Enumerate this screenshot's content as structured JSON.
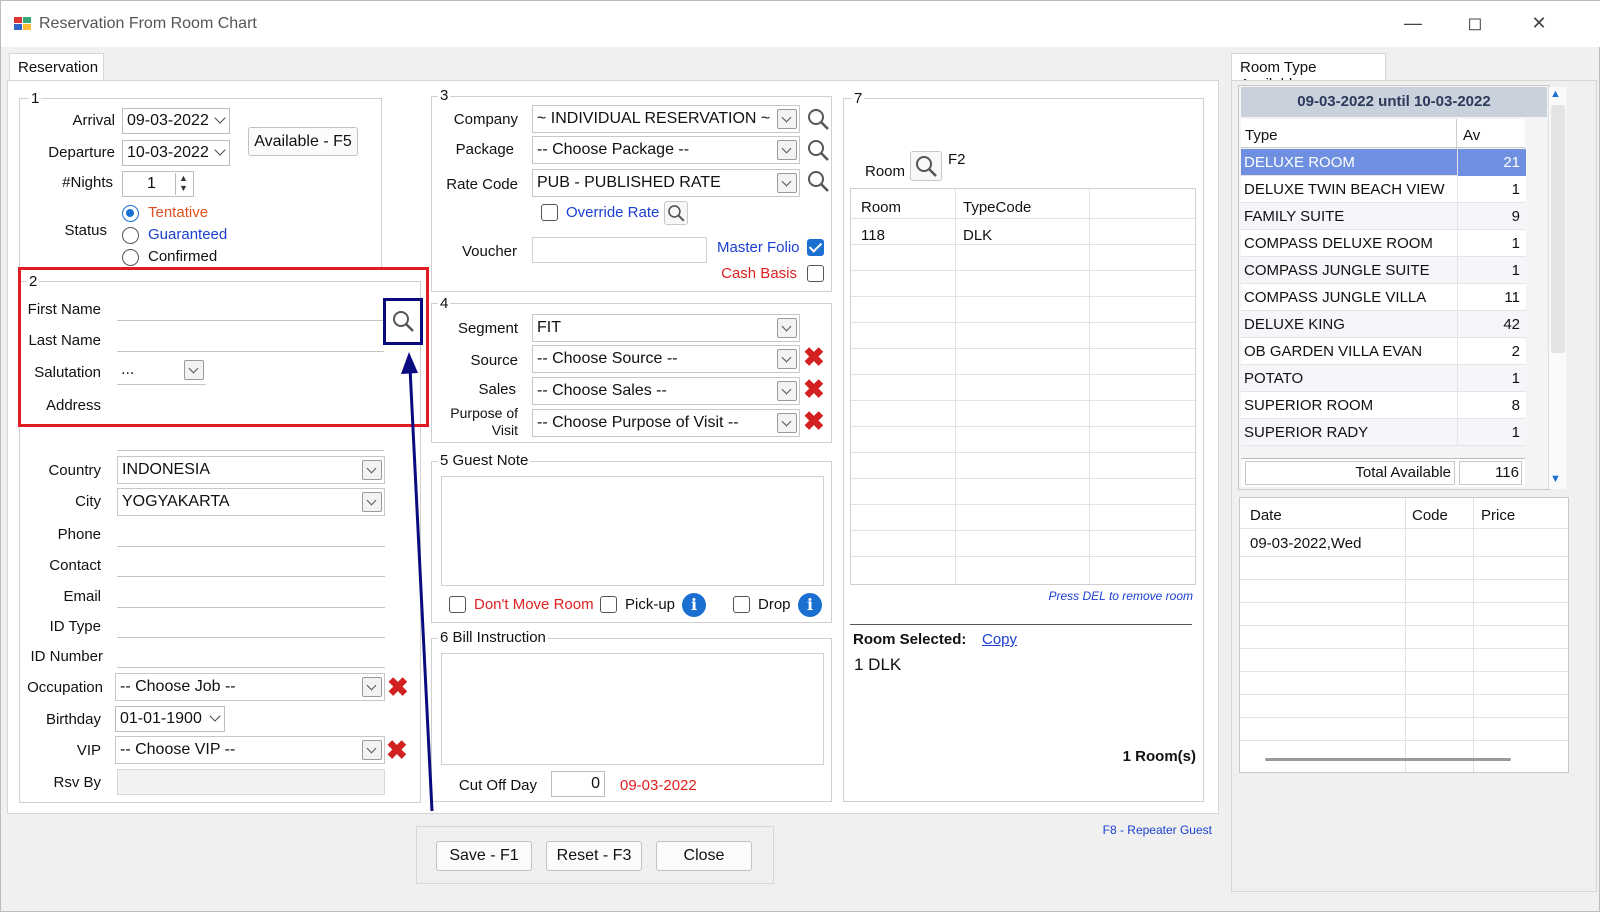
{
  "window": {
    "title": "Reservation From Room Chart"
  },
  "tabs": {
    "reservation": "Reservation",
    "room_type": "Room Type Available"
  },
  "group_labels": {
    "g1": "1",
    "g2": "2",
    "g3": "3",
    "g4": "4",
    "g5": "5 Guest Note",
    "g6": "6 Bill Instruction",
    "g7": "7"
  },
  "section1": {
    "arrival_label": "Arrival",
    "arrival_value": "09-03-2022",
    "departure_label": "Departure",
    "departure_value": "10-03-2022",
    "nights_label": "#Nights",
    "nights_value": "1",
    "available_button": "Available - F5",
    "status_label": "Status",
    "status_options": [
      "Tentative",
      "Guaranteed",
      "Confirmed"
    ],
    "status_selected": "Tentative"
  },
  "section2": {
    "first_name_label": "First Name",
    "first_name_value": "",
    "last_name_label": "Last Name",
    "last_name_value": "",
    "salutation_label": "Salutation",
    "salutation_value": "...",
    "address_label": "Address",
    "address_value": "",
    "country_label": "Country",
    "country_value": "INDONESIA",
    "city_label": "City",
    "city_value": "YOGYAKARTA",
    "phone_label": "Phone",
    "contact_label": "Contact",
    "email_label": "Email",
    "id_type_label": "ID Type",
    "id_number_label": "ID Number",
    "occupation_label": "Occupation",
    "occupation_value": "-- Choose Job --",
    "birthday_label": "Birthday",
    "birthday_value": "01-01-1900",
    "vip_label": "VIP",
    "vip_value": "-- Choose VIP --",
    "rsv_by_label": "Rsv By",
    "rsv_by_value": ""
  },
  "section3": {
    "company_label": "Company",
    "company_value": "~ INDIVIDUAL RESERVATION ~",
    "package_label": "Package",
    "package_value": "-- Choose Package --",
    "rate_code_label": "Rate Code",
    "rate_code_value": "PUB - PUBLISHED RATE",
    "override_rate_label": "Override Rate",
    "override_rate_checked": false,
    "voucher_label": "Voucher",
    "voucher_value": "",
    "master_folio_label": "Master Folio",
    "master_folio_checked": true,
    "cash_basis_label": "Cash Basis",
    "cash_basis_checked": false
  },
  "section4": {
    "segment_label": "Segment",
    "segment_value": "FIT",
    "source_label": "Source",
    "source_value": "-- Choose Source --",
    "sales_label": "Sales",
    "sales_value": "-- Choose Sales --",
    "purpose_label_1": "Purpose of",
    "purpose_label_2": "Visit",
    "purpose_value": "-- Choose Purpose of Visit --"
  },
  "guest_note": {
    "dont_move_room_label": "Don't Move Room",
    "pickup_label": "Pick-up",
    "drop_label": "Drop"
  },
  "bill_instruction": {
    "cut_off_day_label": "Cut Off Day",
    "cut_off_day_value": "0",
    "cut_off_date": "09-03-2022"
  },
  "section7": {
    "room_label": "Room",
    "room_shortcut": "F2",
    "columns": [
      "Room",
      "TypeCode"
    ],
    "rows": [
      {
        "room": "118",
        "type_code": "DLK"
      }
    ],
    "hint": "Press DEL to remove room",
    "room_selected_label": "Room Selected:",
    "copy_link": "Copy",
    "room_selected_value": "1 DLK",
    "rooms_count": "1 Room(s)"
  },
  "room_type_available": {
    "date_range": "09-03-2022 until 10-03-2022",
    "columns": [
      "Type",
      "Av"
    ],
    "rows": [
      {
        "type": "DELUXE ROOM",
        "av": "21"
      },
      {
        "type": "DELUXE TWIN BEACH VIEW",
        "av": "1"
      },
      {
        "type": "FAMILY SUITE",
        "av": "9"
      },
      {
        "type": "COMPASS DELUXE ROOM",
        "av": "1"
      },
      {
        "type": "COMPASS JUNGLE SUITE",
        "av": "1"
      },
      {
        "type": "COMPASS JUNGLE VILLA",
        "av": "11"
      },
      {
        "type": "DELUXE KING",
        "av": "42"
      },
      {
        "type": "OB GARDEN VILLA EVAN",
        "av": "2"
      },
      {
        "type": "POTATO",
        "av": "1"
      },
      {
        "type": "SUPERIOR ROOM",
        "av": "8"
      },
      {
        "type": "SUPERIOR RADY",
        "av": "1"
      }
    ],
    "selected_row": 0,
    "total_label": "Total Available",
    "total_value": "116"
  },
  "price_table": {
    "columns": [
      "Date",
      "Code",
      "Price"
    ],
    "rows": [
      {
        "date": "09-03-2022,Wed",
        "code": "",
        "price": ""
      }
    ]
  },
  "footer": {
    "repeater_link": "F8 - Repeater Guest",
    "save_button": "Save - F1",
    "reset_button": "Reset - F3",
    "close_button": "Close"
  },
  "colors": {
    "highlight_red": "#e31b23",
    "highlight_navy": "#0b0b80",
    "selected_row": "#6f8fe0",
    "header_band": "#c9d1dd",
    "accent_blue": "#1a6fd1"
  }
}
